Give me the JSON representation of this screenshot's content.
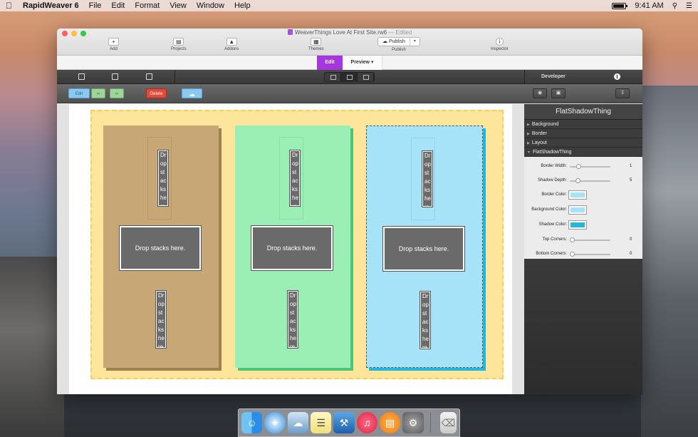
{
  "menubar": {
    "app_name": "RapidWeaver 6",
    "items": [
      "File",
      "Edit",
      "Format",
      "View",
      "Window",
      "Help"
    ],
    "time": "9:41 AM"
  },
  "window": {
    "title": "WeaverThings Love At First Site.rw6",
    "edited": "— Edited"
  },
  "toolbar": {
    "add": "Add",
    "projects": "Projects",
    "addons": "Addons",
    "themes": "Themes",
    "publish_button": "Publish",
    "publish_label": "Publish",
    "inspector": "Inspector"
  },
  "mode": {
    "edit": "Edit",
    "preview": "Preview ▾"
  },
  "sidebar_header": {
    "developer": "Developer"
  },
  "actions": {
    "edit": "Edit",
    "delete": "Delete"
  },
  "canvas": {
    "drop_text": "Drop stacks here.",
    "slim_text": "Drop stacks here",
    "colors": {
      "tan": "#c8a777",
      "green": "#9cefb4",
      "blue": "#a7e3f8",
      "zone": "#fde59b"
    }
  },
  "inspector": {
    "title": "FlatShadowThing",
    "sections": [
      "Background",
      "Border",
      "Layout",
      "FlatShadowThing"
    ],
    "props": {
      "border_width": {
        "label": "Border Width:",
        "value": "1",
        "level": 0.17
      },
      "shadow_depth": {
        "label": "Shadow Depth:",
        "value": "5",
        "level": 0.15
      },
      "border_color": {
        "label": "Border Color:",
        "color": "#a7e3f8"
      },
      "background_color": {
        "label": "Background Color:",
        "color": "#a7e3f8"
      },
      "shadow_color": {
        "label": "Shadow Color:",
        "color": "#25b6de"
      },
      "top_corners": {
        "label": "Top Corners:",
        "value": "0",
        "level": 0
      },
      "bottom_corners": {
        "label": "Bottom Corners:",
        "value": "0",
        "level": 0
      }
    }
  },
  "dock": {
    "apps": [
      "finder-icon",
      "safari-icon",
      "preview-icon",
      "notes-icon",
      "xcode-icon",
      "itunes-icon",
      "ibooks-icon",
      "system-preferences-icon",
      "trash-icon"
    ]
  }
}
